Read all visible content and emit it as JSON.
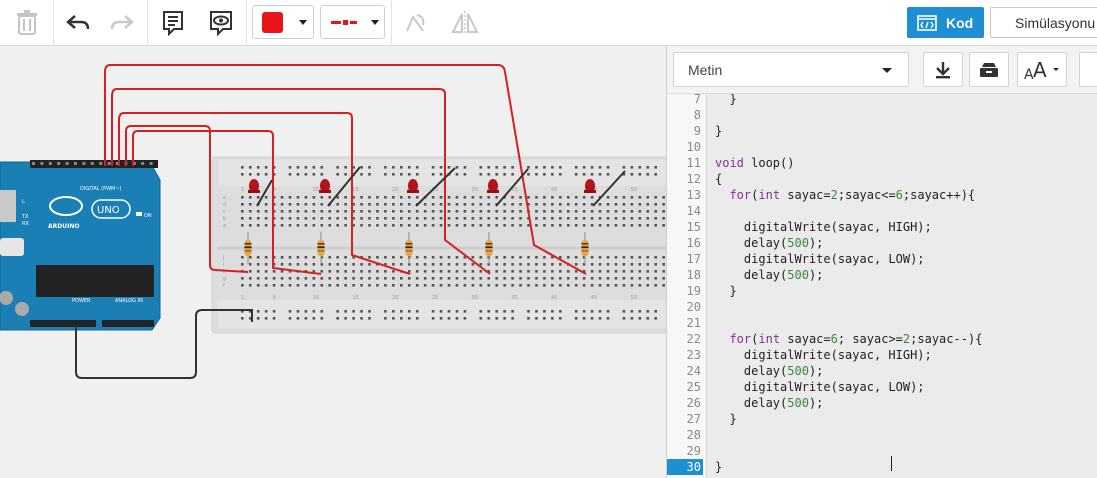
{
  "toolbar": {
    "tools": [
      "delete-icon",
      "undo-icon",
      "redo-icon",
      "notes-icon",
      "view-icon",
      "color-swatch",
      "line-style",
      "rotate-icon",
      "mirror-icon"
    ],
    "color_value": "#e02020",
    "line_color": "#e02020",
    "code_label": "Kod",
    "simulate_label": "Simülasyonu Başlat"
  },
  "arduino": {
    "brand": "ARDUINO",
    "model": "UNO",
    "digital_label": "DIGITAL (PWM~)",
    "power_label": "POWER",
    "analog_label": "ANALOG IN",
    "on_label": "ON",
    "tx_label": "TX",
    "rx_label": "RX",
    "l_label": "L"
  },
  "breadboard": {
    "col_labels": [
      "1",
      "5",
      "10",
      "15",
      "20",
      "25",
      "30",
      "35",
      "40",
      "45",
      "50"
    ],
    "row_labels": [
      "a",
      "b",
      "c",
      "d",
      "e",
      "f",
      "g",
      "h",
      "i",
      "j"
    ]
  },
  "code_panel": {
    "mode": "Metin",
    "active_line": "30",
    "lines": [
      {
        "n": "7",
        "t": "  }"
      },
      {
        "n": "8",
        "t": ""
      },
      {
        "n": "9",
        "t": "}"
      },
      {
        "n": "10",
        "t": ""
      },
      {
        "n": "11",
        "t": "void loop()"
      },
      {
        "n": "12",
        "t": "{"
      },
      {
        "n": "13",
        "t": "  for(int sayac=2;sayac<=6;sayac++){"
      },
      {
        "n": "14",
        "t": ""
      },
      {
        "n": "15",
        "t": "    digitalWrite(sayac, HIGH);"
      },
      {
        "n": "16",
        "t": "    delay(500);"
      },
      {
        "n": "17",
        "t": "    digitalWrite(sayac, LOW);"
      },
      {
        "n": "18",
        "t": "    delay(500);"
      },
      {
        "n": "19",
        "t": "  }"
      },
      {
        "n": "20",
        "t": ""
      },
      {
        "n": "21",
        "t": ""
      },
      {
        "n": "22",
        "t": "  for(int sayac=6; sayac>=2;sayac--){"
      },
      {
        "n": "23",
        "t": "    digitalWrite(sayac, HIGH);"
      },
      {
        "n": "24",
        "t": "    delay(500);"
      },
      {
        "n": "25",
        "t": "    digitalWrite(sayac, LOW);"
      },
      {
        "n": "26",
        "t": "    delay(500);"
      },
      {
        "n": "27",
        "t": "  }"
      },
      {
        "n": "28",
        "t": ""
      },
      {
        "n": "29",
        "t": ""
      },
      {
        "n": "30",
        "t": "}"
      }
    ]
  }
}
